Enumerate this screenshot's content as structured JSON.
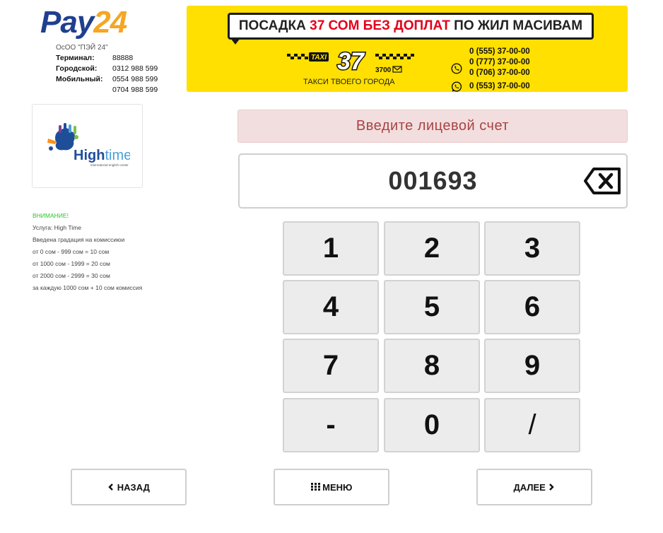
{
  "brand": {
    "part1": "Pay",
    "part2": "24",
    "company": "ОсОО \"ПЭЙ 24\""
  },
  "contacts": [
    {
      "label": "Терминал:",
      "value": "88888"
    },
    {
      "label": "Городской:",
      "value": "0312 988 599"
    },
    {
      "label": "Мобильный:",
      "value": "0554 988 599"
    },
    {
      "label": "",
      "value": "0704 988 599"
    }
  ],
  "banner": {
    "slogan_pre": "ПОСАДКА ",
    "slogan_hl": "37 СОМ БЕЗ ДОПЛАТ",
    "slogan_post": " ПО ЖИЛ МАСИВАМ",
    "taxi_word": "TAXI",
    "taxi_number": "37",
    "taxi_short": "3700",
    "tagline": "ТАКСИ ТВОЕГО ГОРОДА",
    "phones": [
      "0 (555) 37-00-00",
      "0 (777) 37-00-00",
      "0 (706) 37-00-00",
      "0 (553) 37-00-00"
    ]
  },
  "service": {
    "logo_text": "Hightime",
    "logo_subtext": "international english center",
    "notice": [
      "ВНИМАНИЕ!",
      "Услуга: High Time",
      "Введена градация на комиссиюи",
      "от 0 сом - 999 сом = 10 сом",
      "от 1000 сом - 1999 = 20 сом",
      "от 2000 сом - 2999 = 30 сом",
      "за каждую 1000 сом + 10 сом комиссия"
    ]
  },
  "prompt": "Введите лицевой счет",
  "account_value": "001693",
  "keypad": [
    "1",
    "2",
    "3",
    "4",
    "5",
    "6",
    "7",
    "8",
    "9",
    "-",
    "0",
    "/"
  ],
  "nav": {
    "back": "НАЗАД",
    "menu": "МЕНЮ",
    "next": "ДАЛЕЕ"
  },
  "colors": {
    "brand_blue": "#1f3f8f",
    "brand_orange": "#f5a623",
    "banner_yellow": "#ffe000",
    "alert_text": "#a94442",
    "alert_bg": "#f2dedf",
    "notice_green": "#22cc22"
  }
}
